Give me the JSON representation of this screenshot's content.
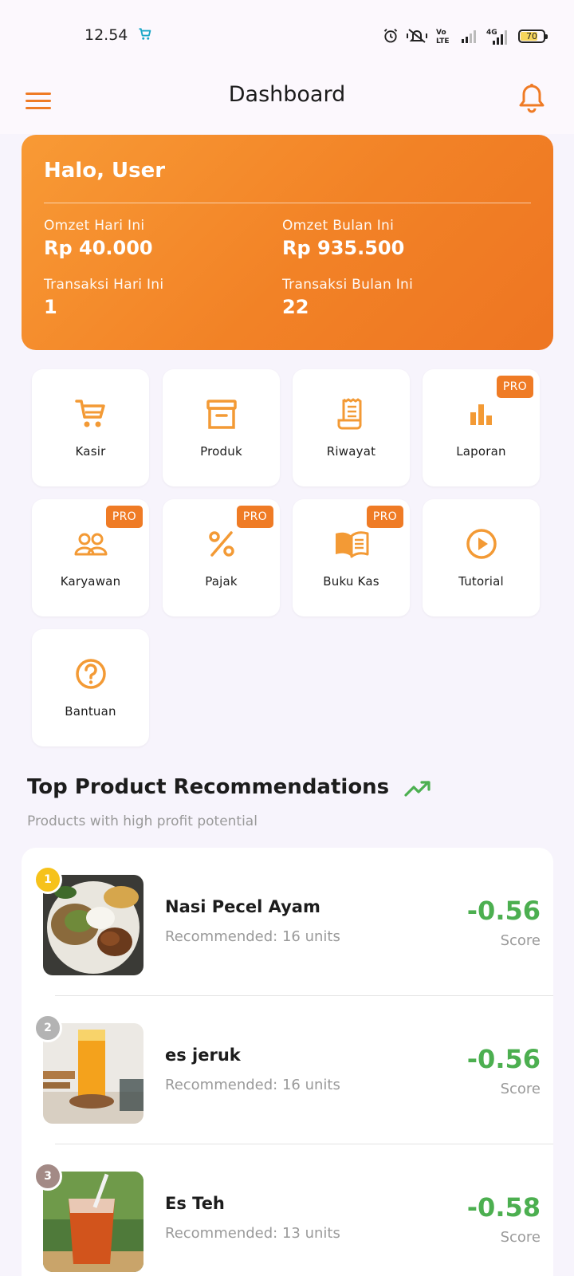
{
  "status_bar": {
    "time": "12.54",
    "battery": "70"
  },
  "appbar": {
    "title": "Dashboard"
  },
  "summary": {
    "greeting": "Halo, User",
    "stats": [
      {
        "label": "Omzet Hari Ini",
        "value": "Rp 40.000"
      },
      {
        "label": "Omzet Bulan Ini",
        "value": "Rp 935.500"
      },
      {
        "label": "Transaksi Hari Ini",
        "value": "1"
      },
      {
        "label": "Transaksi Bulan Ini",
        "value": "22"
      }
    ]
  },
  "menu": {
    "items": [
      {
        "label": "Kasir",
        "icon": "cart-icon",
        "pro": false
      },
      {
        "label": "Produk",
        "icon": "archive-box-icon",
        "pro": false
      },
      {
        "label": "Riwayat",
        "icon": "receipt-icon",
        "pro": false
      },
      {
        "label": "Laporan",
        "icon": "bar-chart-icon",
        "pro": true
      },
      {
        "label": "Karyawan",
        "icon": "people-icon",
        "pro": true
      },
      {
        "label": "Pajak",
        "icon": "percent-icon",
        "pro": true
      },
      {
        "label": "Buku Kas",
        "icon": "open-book-icon",
        "pro": true
      },
      {
        "label": "Tutorial",
        "icon": "play-circle-icon",
        "pro": false
      },
      {
        "label": "Bantuan",
        "icon": "help-circle-icon",
        "pro": false
      }
    ],
    "pro_label": "PRO"
  },
  "recommendations": {
    "title": "Top Product Recommendations",
    "subtitle": "Products with high profit potential",
    "score_label": "Score",
    "items": [
      {
        "rank": "1",
        "name": "Nasi Pecel Ayam",
        "recommended": "Recommended: 16 units",
        "score": "-0.56"
      },
      {
        "rank": "2",
        "name": "es jeruk",
        "recommended": "Recommended: 16 units",
        "score": "-0.56"
      },
      {
        "rank": "3",
        "name": "Es Teh",
        "recommended": "Recommended: 13 units",
        "score": "-0.58"
      }
    ]
  },
  "colors": {
    "accent": "#ef7b25",
    "icon_orange": "#f39a35",
    "score_green": "#4caf50",
    "rank_gold": "#f6c21b",
    "rank_silver": "#b3b3b3",
    "rank_bronze": "#a38a86"
  }
}
